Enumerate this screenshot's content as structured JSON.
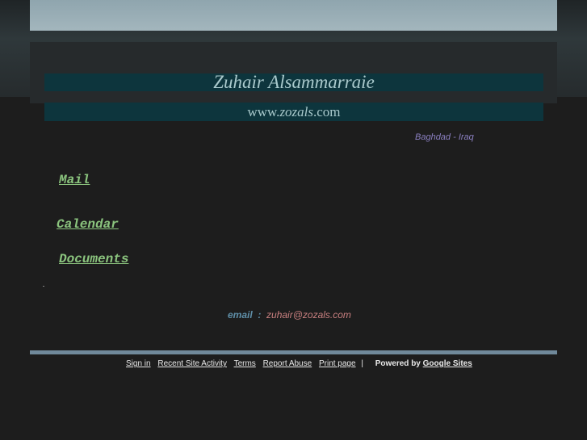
{
  "header": {
    "title": "Zuhair Alsammarraie",
    "url_prefix": "www.",
    "url_domain": "zozals",
    "url_suffix": ".com",
    "location": "Baghdad - Iraq"
  },
  "links": [
    {
      "label": "Mail"
    },
    {
      "label": "Calendar"
    },
    {
      "label": "Documents"
    }
  ],
  "contact": {
    "label": "email  :",
    "value": "zuhair@zozals.com"
  },
  "footer": {
    "sign_in": "Sign in",
    "recent": "Recent Site Activity",
    "terms": "Terms",
    "report": "Report Abuse",
    "print": "Print page",
    "separator": "|",
    "powered": "Powered by",
    "google_sites": "Google Sites"
  }
}
